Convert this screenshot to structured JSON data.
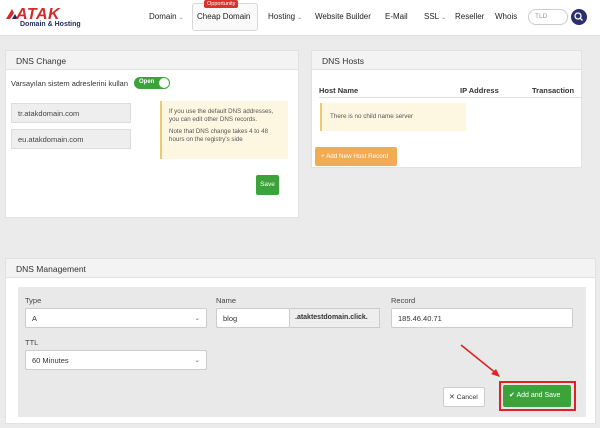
{
  "header": {
    "logo": {
      "brand": "ATAK",
      "tagline": "Domain & Hosting"
    },
    "nav": [
      {
        "label": "Domain",
        "has_dropdown": true
      },
      {
        "label": "Cheap Domain",
        "badge": "Opportunity",
        "active": true
      },
      {
        "label": "Hosting",
        "has_dropdown": true
      },
      {
        "label": "Website Builder"
      },
      {
        "label": "E-Mail"
      },
      {
        "label": "SSL",
        "has_dropdown": true
      },
      {
        "label": "Reseller"
      },
      {
        "label": "Whois"
      }
    ],
    "tld_placeholder": "TLD"
  },
  "dns_change": {
    "title": "DNS Change",
    "default_label": "Varsayılan sistem adreslerini kullan",
    "toggle_label": "Open",
    "nameservers": [
      "tr.atakdomain.com",
      "eu.atakdomain.com"
    ],
    "info": [
      "If you use the default DNS addresses, you can edit other DNS records.",
      "Note that DNS change takes 4 to 48 hours on the registry's side"
    ],
    "save_label": "Save"
  },
  "dns_hosts": {
    "title": "DNS Hosts",
    "columns": [
      "Host Name",
      "IP Address",
      "Transaction"
    ],
    "empty_message": "There is no child name server",
    "add_button": "+ Add New Host Record"
  },
  "dns_management": {
    "title": "DNS Management",
    "type_label": "Type",
    "type_value": "A",
    "name_label": "Name",
    "name_value": "blog",
    "name_suffix": ".ataktestdomain.click.",
    "record_label": "Record",
    "record_value": "185.46.40.71",
    "ttl_label": "TTL",
    "ttl_value": "60 Minutes",
    "cancel_label": "Cancel",
    "add_save_label": "Add and Save"
  },
  "colors": {
    "brand_red": "#d42a2a",
    "brand_navy": "#1d2b5c",
    "success_green": "#3ca33a",
    "warning_orange": "#f2ab52",
    "info_bg": "#fdf6e1",
    "annotation_red": "#e22222"
  }
}
